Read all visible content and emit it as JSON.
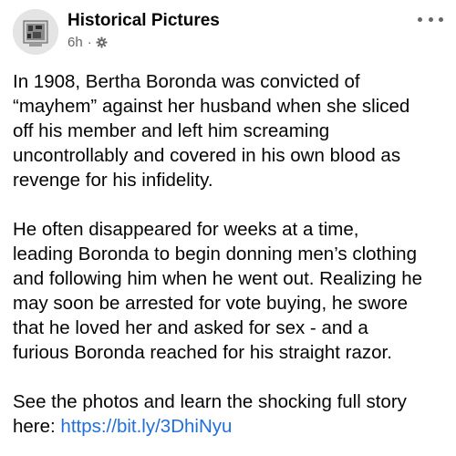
{
  "post": {
    "page_name": "Historical Pictures",
    "time": "6h",
    "separator": "·",
    "icons": {
      "avatar": "historical-pictures-avatar",
      "audience": "gear-icon",
      "more": "more-options-icon"
    },
    "paragraph1": [
      "In 1908, Bertha Boronda was convicted of",
      "“mayhem” against her husband when she sliced",
      "off his member and left him screaming",
      "uncontrollably and covered in his own blood as",
      "revenge for his infidelity."
    ],
    "paragraph2": [
      "He often disappeared for weeks at a time,",
      "leading Boronda to begin donning men’s clothing",
      "and following him when he went out. Realizing he",
      "may soon be arrested for vote buying, he swore",
      "that he loved her and asked for sex - and a",
      "furious Boronda reached for his straight razor."
    ],
    "paragraph3": [
      "See the photos and learn the shocking full story"
    ],
    "link_prefix": "here: ",
    "link_text": "https://bit.ly/3DhiNyu",
    "link_color": "#216fdb"
  }
}
